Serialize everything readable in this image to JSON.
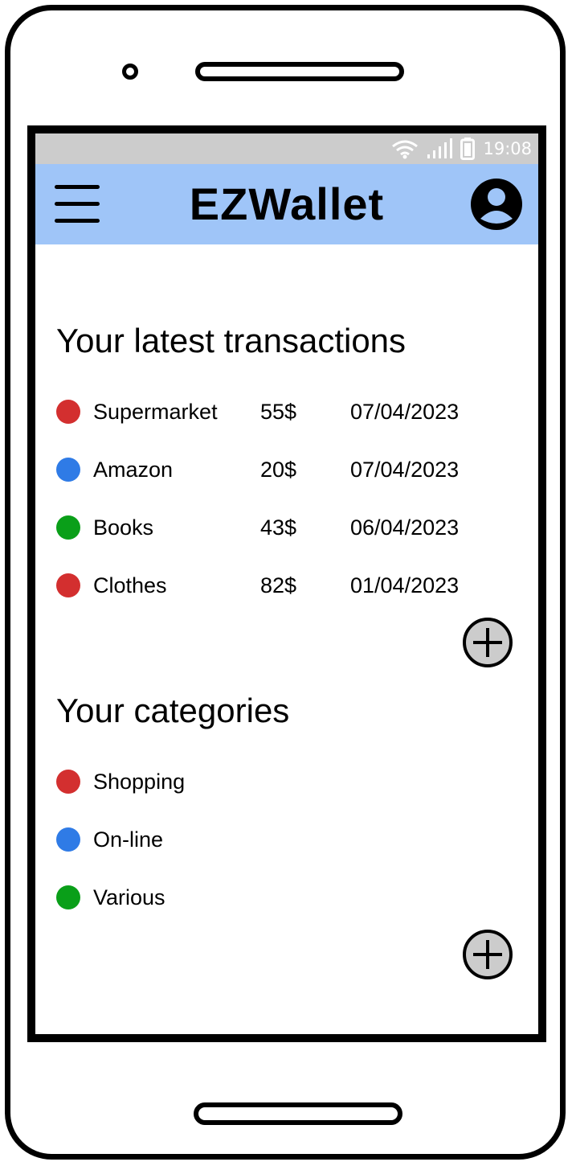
{
  "status_bar": {
    "time": "19:08",
    "icons": [
      "wifi-icon",
      "signal-icon",
      "battery-icon"
    ]
  },
  "app_bar": {
    "title": "EZWallet",
    "icons": [
      "menu-icon",
      "profile-icon"
    ]
  },
  "transactions": {
    "heading": "Your latest transactions",
    "items": [
      {
        "name": "Supermarket",
        "amount": "55$",
        "date": "07/04/2023",
        "color": "#d32f2f"
      },
      {
        "name": "Amazon",
        "amount": "20$",
        "date": "07/04/2023",
        "color": "#2f7be6"
      },
      {
        "name": "Books",
        "amount": "43$",
        "date": "06/04/2023",
        "color": "#0a9f19"
      },
      {
        "name": "Clothes",
        "amount": "82$",
        "date": "01/04/2023",
        "color": "#d32f2f"
      }
    ],
    "add_icon": "plus-circle-icon"
  },
  "categories": {
    "heading": "Your categories",
    "items": [
      {
        "name": "Shopping",
        "color": "#d32f2f"
      },
      {
        "name": "On-line",
        "color": "#2f7be6"
      },
      {
        "name": "Various",
        "color": "#0a9f19"
      }
    ],
    "add_icon": "plus-circle-icon"
  }
}
